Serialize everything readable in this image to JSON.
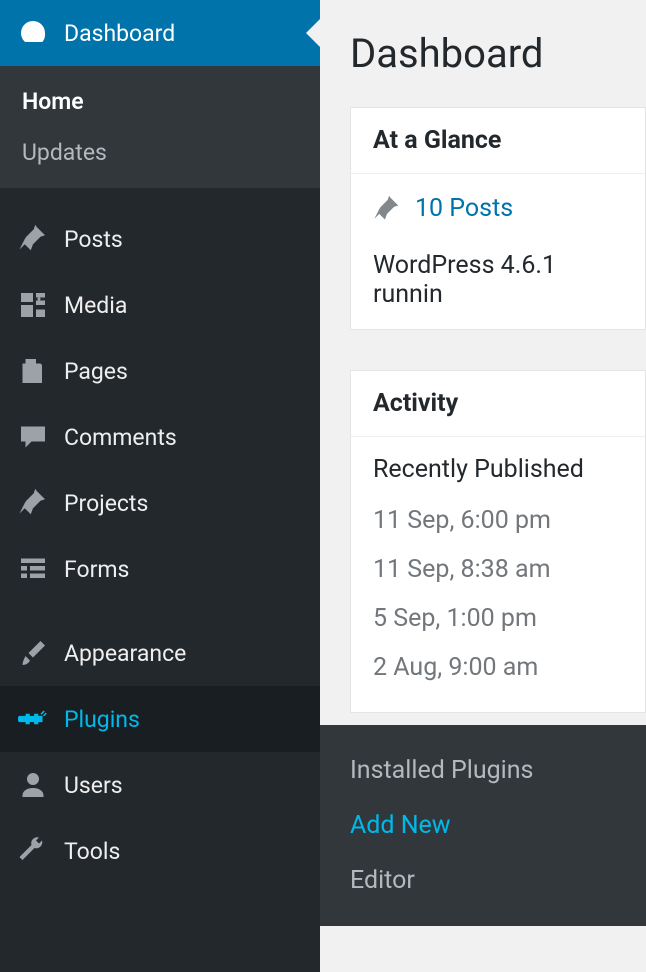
{
  "sidebar": {
    "dashboard": "Dashboard",
    "posts": "Posts",
    "media": "Media",
    "pages": "Pages",
    "comments": "Comments",
    "projects": "Projects",
    "forms": "Forms",
    "appearance": "Appearance",
    "plugins": "Plugins",
    "users": "Users",
    "tools": "Tools"
  },
  "subnav": {
    "home": "Home",
    "updates": "Updates"
  },
  "content": {
    "title": "Dashboard",
    "atGlance": {
      "header": "At a Glance",
      "postsCount": "10 Posts",
      "running": "WordPress 4.6.1 runnin"
    },
    "activity": {
      "header": "Activity",
      "subtitle": "Recently Published",
      "dates": [
        "11 Sep, 6:00 pm",
        "11 Sep, 8:38 am",
        "5 Sep, 1:00 pm",
        "2 Aug, 9:00 am"
      ]
    }
  },
  "flyout": {
    "installed": "Installed Plugins",
    "addNew": "Add New",
    "editor": "Editor"
  }
}
